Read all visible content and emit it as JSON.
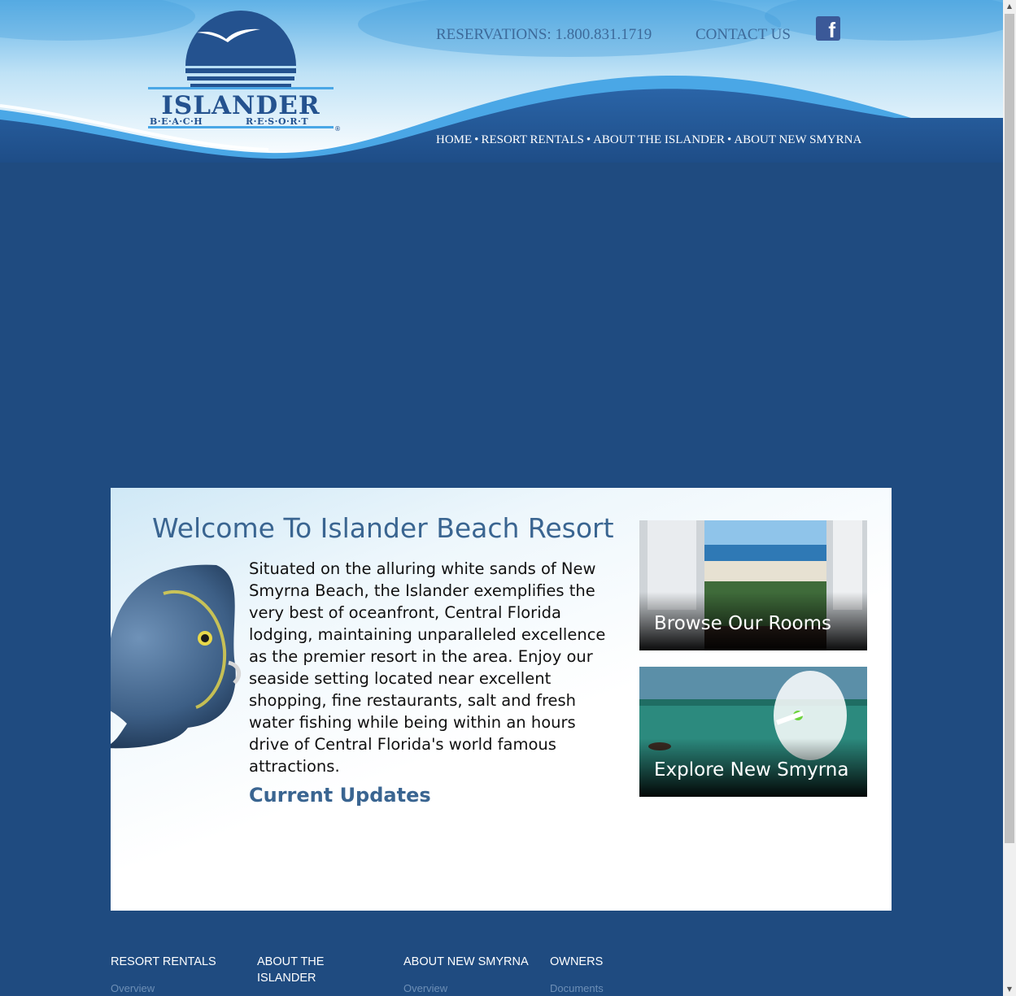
{
  "logo": {
    "wordmark": "ISLANDER",
    "sub_left": "B·E·A·C·H",
    "sub_right": "R·E·S·O·R·T",
    "registered": "®"
  },
  "header": {
    "reservations": "RESERVATIONS: 1.800.831.1719",
    "contact": "CONTACT US",
    "facebook_glyph": "f"
  },
  "nav": {
    "items": [
      "HOME",
      "RESORT RENTALS",
      "ABOUT THE ISLANDER",
      "ABOUT NEW SMYRNA"
    ],
    "separator": "•"
  },
  "main": {
    "title": "Welcome To Islander Beach Resort",
    "intro": "Situated on the alluring white sands of New Smyrna Beach, the Islander exemplifies the very best of oceanfront, Central Florida lodging, maintaining unparalleled excellence as the premier resort in the area. Enjoy our seaside setting located near excellent shopping, fine restaurants, salt and fresh water fishing while being within an hours drive of Central Florida's world famous attractions.",
    "updates_heading": "Current Updates"
  },
  "promos": {
    "rooms": "Browse Our Rooms",
    "explore": "Explore New Smyrna"
  },
  "footer": {
    "col1_title": "RESORT RENTALS",
    "col1_sub": "Overview",
    "col2_title": "ABOUT THE ISLANDER",
    "col3_title": "ABOUT NEW SMYRNA",
    "col3_sub": "Overview",
    "col4_title": "OWNERS",
    "col4_sub": "Documents"
  },
  "colors": {
    "page_bg": "#1f4b80",
    "brand_blue": "#24528f",
    "heading_blue": "#3a6591",
    "header_link": "#3d6a9a"
  },
  "icons": {
    "facebook": "facebook-icon",
    "logo_bird": "seagull-icon"
  }
}
